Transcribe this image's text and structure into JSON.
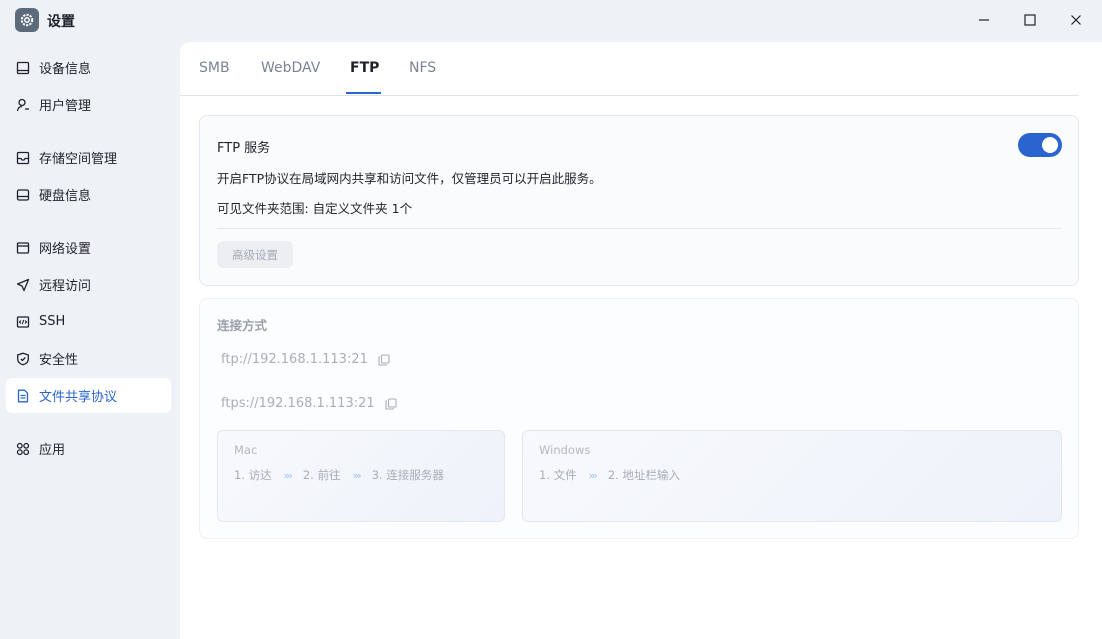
{
  "window": {
    "title": "设置",
    "app_icon": "gear-icon",
    "controls": [
      "minimize-icon",
      "maximize-icon",
      "close-icon"
    ]
  },
  "sidebar": {
    "items": [
      {
        "label": "设备信息",
        "icon": "device-icon"
      },
      {
        "label": "用户管理",
        "icon": "user-icon"
      },
      {
        "label": "存储空间管理",
        "icon": "storage-icon"
      },
      {
        "label": "硬盘信息",
        "icon": "disk-icon"
      },
      {
        "label": "网络设置",
        "icon": "network-icon"
      },
      {
        "label": "远程访问",
        "icon": "send-icon"
      },
      {
        "label": "SSH",
        "icon": "code-icon"
      },
      {
        "label": "安全性",
        "icon": "shield-icon"
      },
      {
        "label": "文件共享协议",
        "icon": "document-icon",
        "active": true
      },
      {
        "label": "应用",
        "icon": "apps-icon"
      }
    ]
  },
  "tabs": [
    {
      "label": "SMB"
    },
    {
      "label": "WebDAV"
    },
    {
      "label": "FTP",
      "active": true
    },
    {
      "label": "NFS"
    }
  ],
  "ftp": {
    "title": "FTP 服务",
    "enabled": true,
    "description": "开启FTP协议在局域网内共享和访问文件，仅管理员可以开启此服务。",
    "scope": "可见文件夹范围:  自定义文件夹 1个",
    "advanced_button": "高级设置"
  },
  "connection": {
    "title": "连接方式",
    "urls": [
      "ftp://192.168.1.113:21",
      "ftps://192.168.1.113:21"
    ],
    "mac": {
      "name": "Mac",
      "steps": [
        "1. 访达",
        "2. 前往",
        "3. 连接服务器"
      ]
    },
    "windows": {
      "name": "Windows",
      "steps": [
        "1. 文件",
        "2. 地址栏输入"
      ]
    },
    "step_arrow": "›››"
  },
  "colors": {
    "accent": "#2a64cf",
    "background": "#eef1f6",
    "panel": "#ffffff"
  }
}
